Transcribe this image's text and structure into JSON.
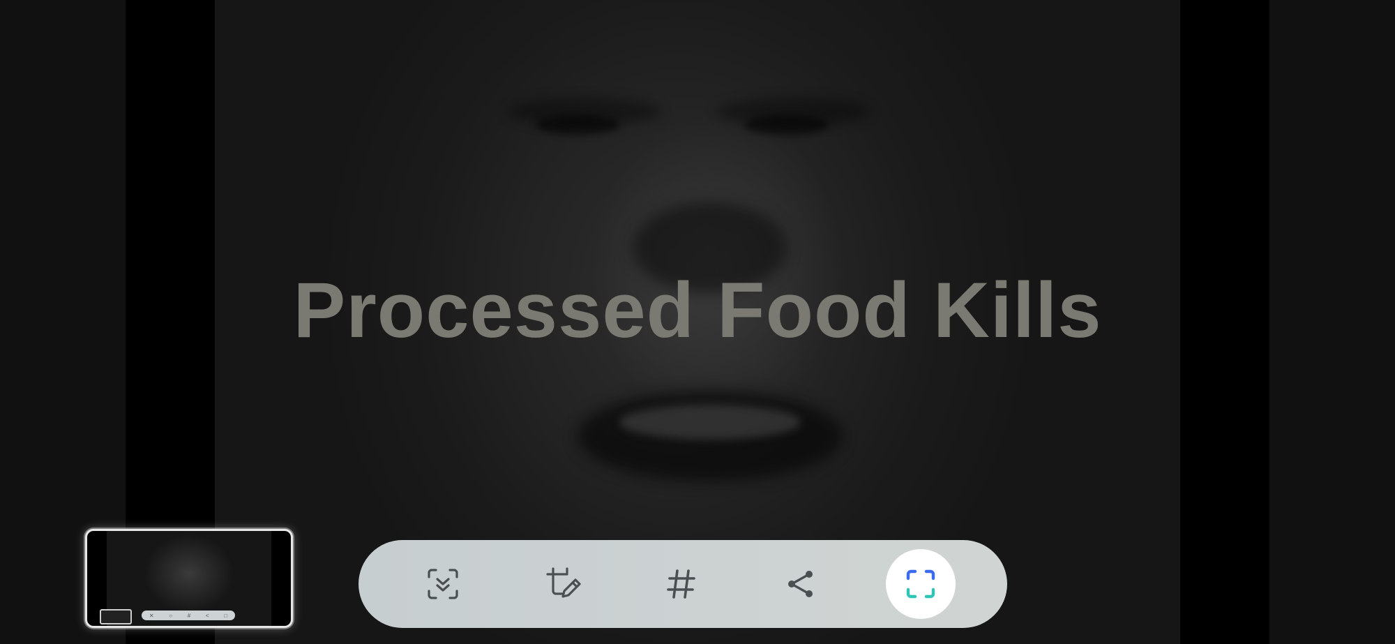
{
  "overlay": {
    "headline": "Processed Food Kills"
  },
  "thumbnail": {
    "toolbar_glyphs": [
      "✕",
      "○",
      "#",
      "<",
      "□"
    ]
  },
  "toolbar": {
    "buttons": [
      {
        "icon": "scroll-capture-icon",
        "active": false
      },
      {
        "icon": "crop-edit-icon",
        "active": false
      },
      {
        "icon": "hashtag-icon",
        "active": false
      },
      {
        "icon": "share-icon",
        "active": false
      },
      {
        "icon": "smart-select-icon",
        "active": true
      }
    ]
  },
  "colors": {
    "headline": "#7a7a72",
    "toolbar_bg": "#cbd1d2",
    "icon": "#4a4f52",
    "accent_blue": "#3b6cf0",
    "accent_teal": "#2ec4b6"
  }
}
